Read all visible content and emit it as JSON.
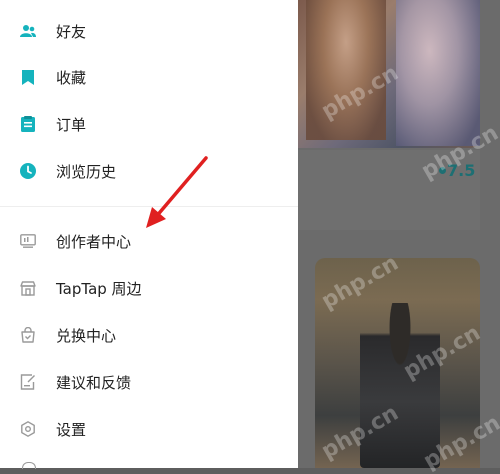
{
  "drawer": {
    "items": [
      {
        "label": "好友",
        "icon": "friends-icon"
      },
      {
        "label": "收藏",
        "icon": "bookmark-icon"
      },
      {
        "label": "订单",
        "icon": "order-icon"
      },
      {
        "label": "浏览历史",
        "icon": "clock-icon"
      },
      {
        "label": "创作者中心",
        "icon": "creator-icon"
      },
      {
        "label": "TapTap 周边",
        "icon": "merch-icon"
      },
      {
        "label": "兑换中心",
        "icon": "exchange-icon"
      },
      {
        "label": "建议和反馈",
        "icon": "feedback-icon"
      },
      {
        "label": "设置",
        "icon": "settings-icon"
      }
    ]
  },
  "background": {
    "score": "7.5"
  },
  "watermark": {
    "text": "php.cn"
  },
  "colors": {
    "accent": "#15b3bd",
    "icon_gray": "#9a9a9a",
    "arrow": "#e02020"
  }
}
